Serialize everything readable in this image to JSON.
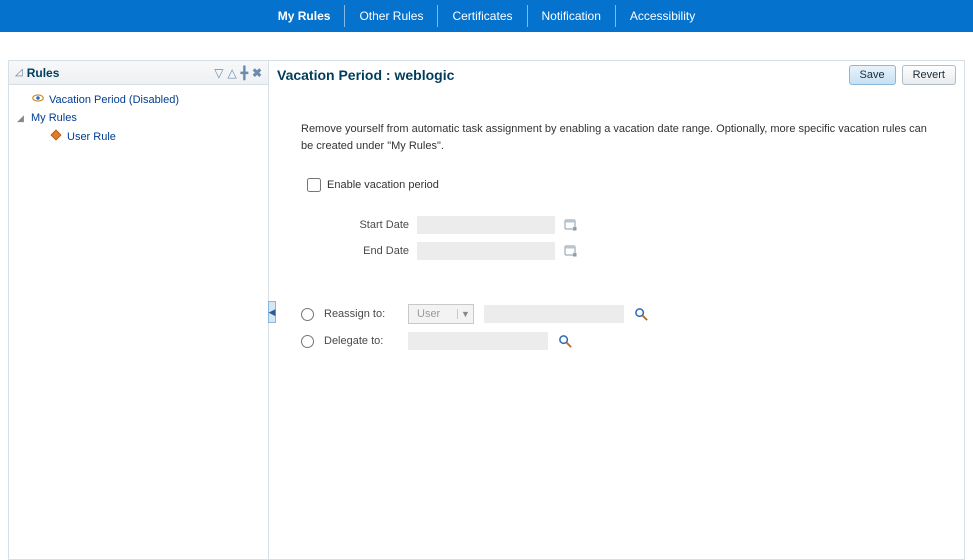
{
  "topbar": {
    "items": [
      {
        "label": "My Rules",
        "active": true
      },
      {
        "label": "Other Rules"
      },
      {
        "label": "Certificates"
      },
      {
        "label": "Notification"
      },
      {
        "label": "Accessibility"
      }
    ]
  },
  "sidebar": {
    "title": "Rules",
    "tree": {
      "vacation": "Vacation Period (Disabled)",
      "myrules": "My Rules",
      "userrule": "User Rule"
    }
  },
  "content": {
    "title": "Vacation Period : weblogic",
    "save": "Save",
    "revert": "Revert",
    "help": "Remove yourself from automatic task assignment by enabling a vacation date range. Optionally, more specific vacation rules can be created under \"My Rules\".",
    "enableLabel": "Enable vacation period",
    "startDateLabel": "Start Date",
    "endDateLabel": "End Date",
    "startDate": "",
    "endDate": "",
    "reassignLabel": "Reassign to:",
    "delegateLabel": "Delegate to:",
    "reassignType": "User",
    "reassignValue": "",
    "delegateValue": ""
  }
}
